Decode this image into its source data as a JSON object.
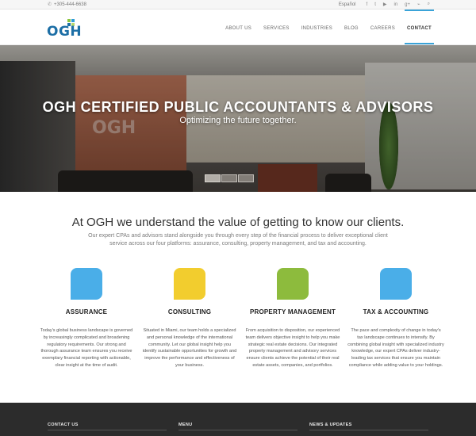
{
  "topbar": {
    "phone": "+305-444-6638",
    "language": "Español",
    "social_icons": [
      "facebook-icon",
      "twitter-icon",
      "youtube-icon",
      "linkedin-icon",
      "googleplus-icon",
      "rss-icon",
      "search-icon"
    ],
    "social_glyphs": [
      "f",
      "t",
      "▶",
      "in",
      "g+",
      "⌁",
      "⌕"
    ]
  },
  "header": {
    "logo_text": "OGH",
    "logo_colors": [
      "#8cc63f",
      "#2e9cd7",
      "#1d6fa6"
    ],
    "nav": [
      "ABOUT US",
      "SERVICES",
      "INDUSTRIES",
      "BLOG",
      "CAREERS",
      "CONTACT"
    ],
    "active_nav": "CONTACT",
    "accent_color": "#3aa3d8"
  },
  "hero": {
    "wall_logo": "OGH",
    "title": "OGH CERTIFIED PUBLIC ACCOUNTANTS & ADVISORS",
    "tagline": "Optimizing the future together.",
    "slide_count": 3,
    "active_slide": 1
  },
  "intro": {
    "title": "At OGH we understand the value of getting to know our clients.",
    "text": "Our expert CPAs and advisors stand alongside you through every step of the financial process to deliver exceptional client service across our four platforms: assurance, consulting, property management, and tax and accounting."
  },
  "services": [
    {
      "title": "ASSURANCE",
      "color": "#4aaee8",
      "text": "Today's global business landscape is governed by increasingly complicated and broadening regulatory requirements. Our strong and thorough assurance team ensures you receive exemplary financial reporting with actionable, clear insight at the time of audit."
    },
    {
      "title": "CONSULTING",
      "color": "#f2cd2e",
      "text": "Situated in Miami, our team holds a specialized and personal knowledge of the international community. Let our global insight help you identify sustainable opportunities for growth and improve the performance and effectiveness of your business."
    },
    {
      "title": "PROPERTY MANAGEMENT",
      "color": "#8dbb3d",
      "text": "From acquisition to disposition, our experienced team delivers objective insight to help you make strategic real estate decisions. Our integrated property management and advisory services ensure clients achieve the potential of their real estate assets, companies, and portfolios."
    },
    {
      "title": "TAX & ACCOUNTING",
      "color": "#4aaee8",
      "text": "The pace and complexity of change in today's tax landscape continues to intensify. By combining global insight with specialized industry knowledge, our expert CPAs deliver industry-leading tax services that ensure you maintain compliance while adding value to your holdings."
    }
  ],
  "footer": {
    "columns": [
      "CONTACT US",
      "MENU",
      "NEWS & UPDATES"
    ]
  }
}
